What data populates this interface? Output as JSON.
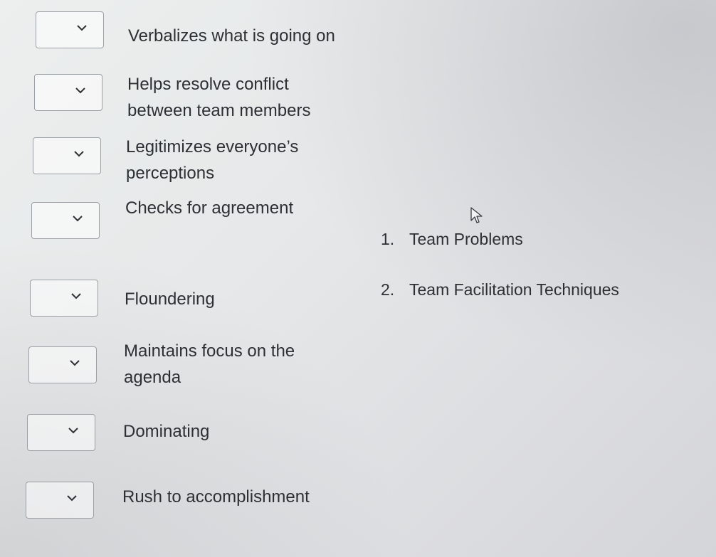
{
  "prompts": [
    {
      "text": "Verbalizes what is going on",
      "selected": ""
    },
    {
      "text": "Helps resolve conflict\nbetween team members",
      "selected": ""
    },
    {
      "text": "Legitimizes everyone’s\nperceptions",
      "selected": ""
    },
    {
      "text": "Checks for agreement",
      "selected": ""
    },
    {
      "text": "Floundering",
      "selected": ""
    },
    {
      "text": "Maintains focus on the\nagenda",
      "selected": ""
    },
    {
      "text": "Dominating",
      "selected": ""
    },
    {
      "text": "Rush to accomplishment",
      "selected": ""
    }
  ],
  "answers": [
    {
      "number": "1.",
      "label": "Team Problems"
    },
    {
      "number": "2.",
      "label": "Team Facilitation Techniques"
    }
  ],
  "icons": {
    "dropdown": "chevron-down-icon",
    "pointer": "mouse-pointer-icon"
  }
}
